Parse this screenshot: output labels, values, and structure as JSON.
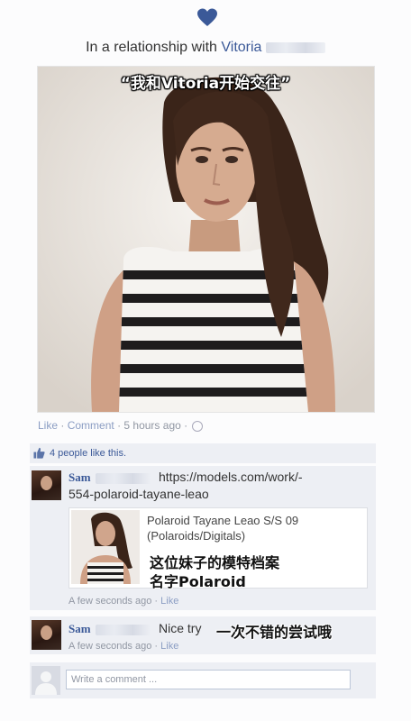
{
  "status": {
    "prefix": "In a relationship with",
    "partner_name": "Vitoria",
    "caption_overlay": "“我和Vitoria开始交往”"
  },
  "post_actions": {
    "like": "Like",
    "comment": "Comment",
    "time": "5 hours ago"
  },
  "likes": {
    "text": "4 people like this."
  },
  "comments": [
    {
      "author": "Sam",
      "text_line1": "https://models.com/work/-",
      "text_line2": "554-polaroid-tayane-leao",
      "link_title_line1": "Polaroid Tayane Leao S/S 09",
      "link_title_line2": "(Polaroids/Digitals)",
      "overlay_line1": "这位妹子的模特档案",
      "overlay_line2": "名字Polaroid",
      "time": "A few seconds ago",
      "like": "Like"
    },
    {
      "author": "Sam",
      "text": "Nice try",
      "overlay": "一次不错的尝试哦",
      "time": "A few seconds ago",
      "like": "Like"
    }
  ],
  "comment_box": {
    "placeholder": "Write a comment ..."
  },
  "colors": {
    "brand": "#3b5998",
    "heart": "#3b5998",
    "comment_bg": "#edeff4"
  }
}
